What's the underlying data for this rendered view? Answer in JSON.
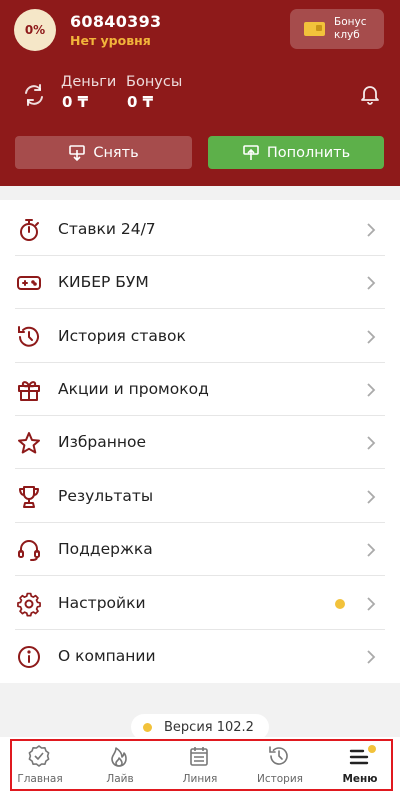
{
  "profile": {
    "level_percent": "0%",
    "user_id": "60840393",
    "level_name": "Нет уровня",
    "bonus_club_label": "Бонус клуб"
  },
  "balance": {
    "money_label": "Деньги",
    "money_value": "0 ₸",
    "bonus_label": "Бонусы",
    "bonus_value": "0 ₸"
  },
  "actions": {
    "withdraw_label": "Снять",
    "deposit_label": "Пополнить"
  },
  "menu": {
    "items": [
      {
        "label": "Ставки 24/7",
        "icon": "stopwatch-icon"
      },
      {
        "label": "КИБЕР БУМ",
        "icon": "gamepad-icon"
      },
      {
        "label": "История ставок",
        "icon": "history-icon"
      },
      {
        "label": "Акции и промокод",
        "icon": "gift-icon"
      },
      {
        "label": "Избранное",
        "icon": "star-icon"
      },
      {
        "label": "Результаты",
        "icon": "trophy-icon"
      },
      {
        "label": "Поддержка",
        "icon": "headset-icon"
      },
      {
        "label": "Настройки",
        "icon": "gear-icon",
        "badge": true
      },
      {
        "label": "О компании",
        "icon": "info-icon"
      }
    ]
  },
  "version": {
    "label": "Версия 102.2"
  },
  "tabbar": {
    "tabs": [
      {
        "label": "Главная",
        "icon": "home-badge-icon"
      },
      {
        "label": "Лайв",
        "icon": "fire-icon"
      },
      {
        "label": "Линия",
        "icon": "calendar-icon"
      },
      {
        "label": "История",
        "icon": "history-icon"
      },
      {
        "label": "Меню",
        "icon": "menu-icon",
        "active": true
      }
    ]
  },
  "colors": {
    "header_bg": "#8e1a1a",
    "accent_gold": "#f2b43b",
    "deposit_green": "#5db04a",
    "icon_red": "#8e1a1a",
    "highlight_outline": "#e0191f"
  }
}
